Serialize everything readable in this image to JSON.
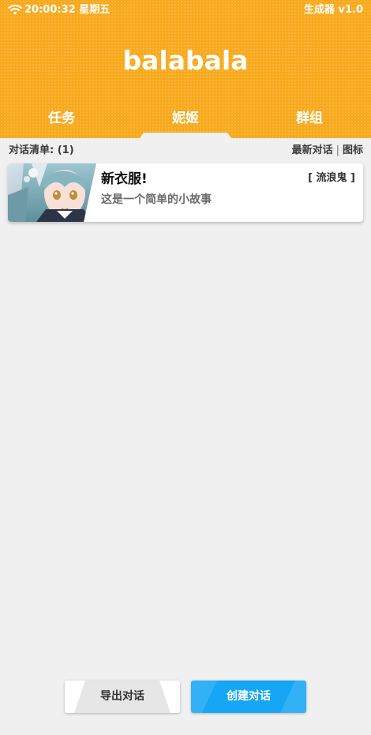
{
  "status_bar": {
    "time": "20:00:32 星期五",
    "version": "生成器 v1.0",
    "wifi_icon": "wifi-icon"
  },
  "header": {
    "title": "balabala",
    "tabs": [
      {
        "label": "任务"
      },
      {
        "label": "妮姬"
      },
      {
        "label": "群组"
      }
    ],
    "active_tab": 1
  },
  "list": {
    "count_label": "对话清单: (1)",
    "sort_label": "最新对话",
    "separator": "|",
    "view_label": "图标",
    "items": [
      {
        "title": "新衣服!",
        "author": "[ 流浪鬼 ]",
        "subtitle": "这是一个简单的小故事",
        "avatar_icon": "character-portrait"
      }
    ]
  },
  "actions": {
    "export_label": "导出对话",
    "create_label": "创建对话"
  },
  "colors": {
    "header": "#f8a91c",
    "background": "#f0f0f0",
    "primary_button": "#16a6f5"
  }
}
